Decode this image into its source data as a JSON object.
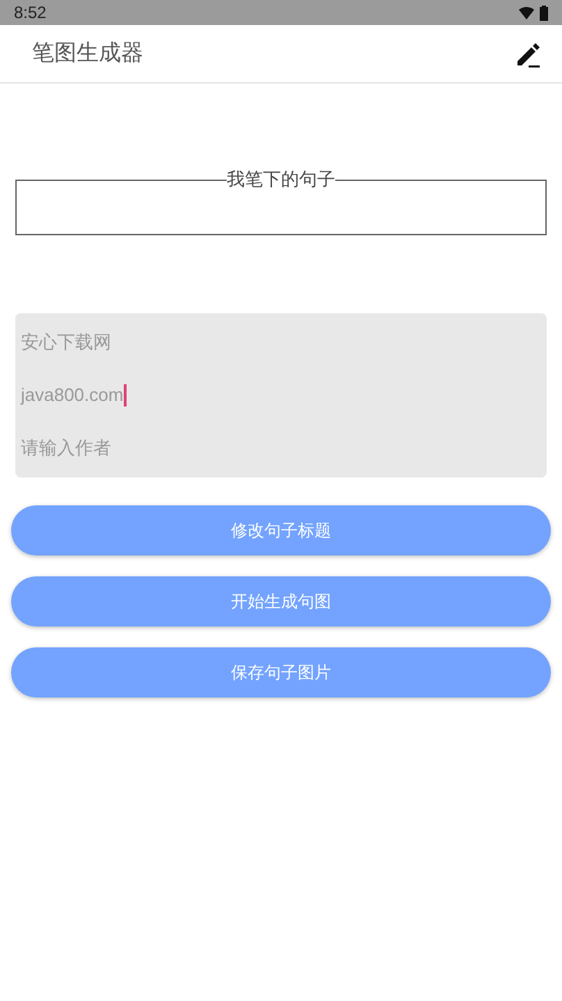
{
  "status_bar": {
    "time": "8:52"
  },
  "app_bar": {
    "title": "笔图生成器"
  },
  "sentence_box": {
    "legend": "我笔下的句子"
  },
  "fields": [
    {
      "value": "安心下载网",
      "focused": false
    },
    {
      "value": "java800.com",
      "focused": true
    },
    {
      "placeholder": "请输入作者",
      "focused": false
    }
  ],
  "buttons": [
    "修改句子标题",
    "开始生成句图",
    "保存句子图片"
  ]
}
